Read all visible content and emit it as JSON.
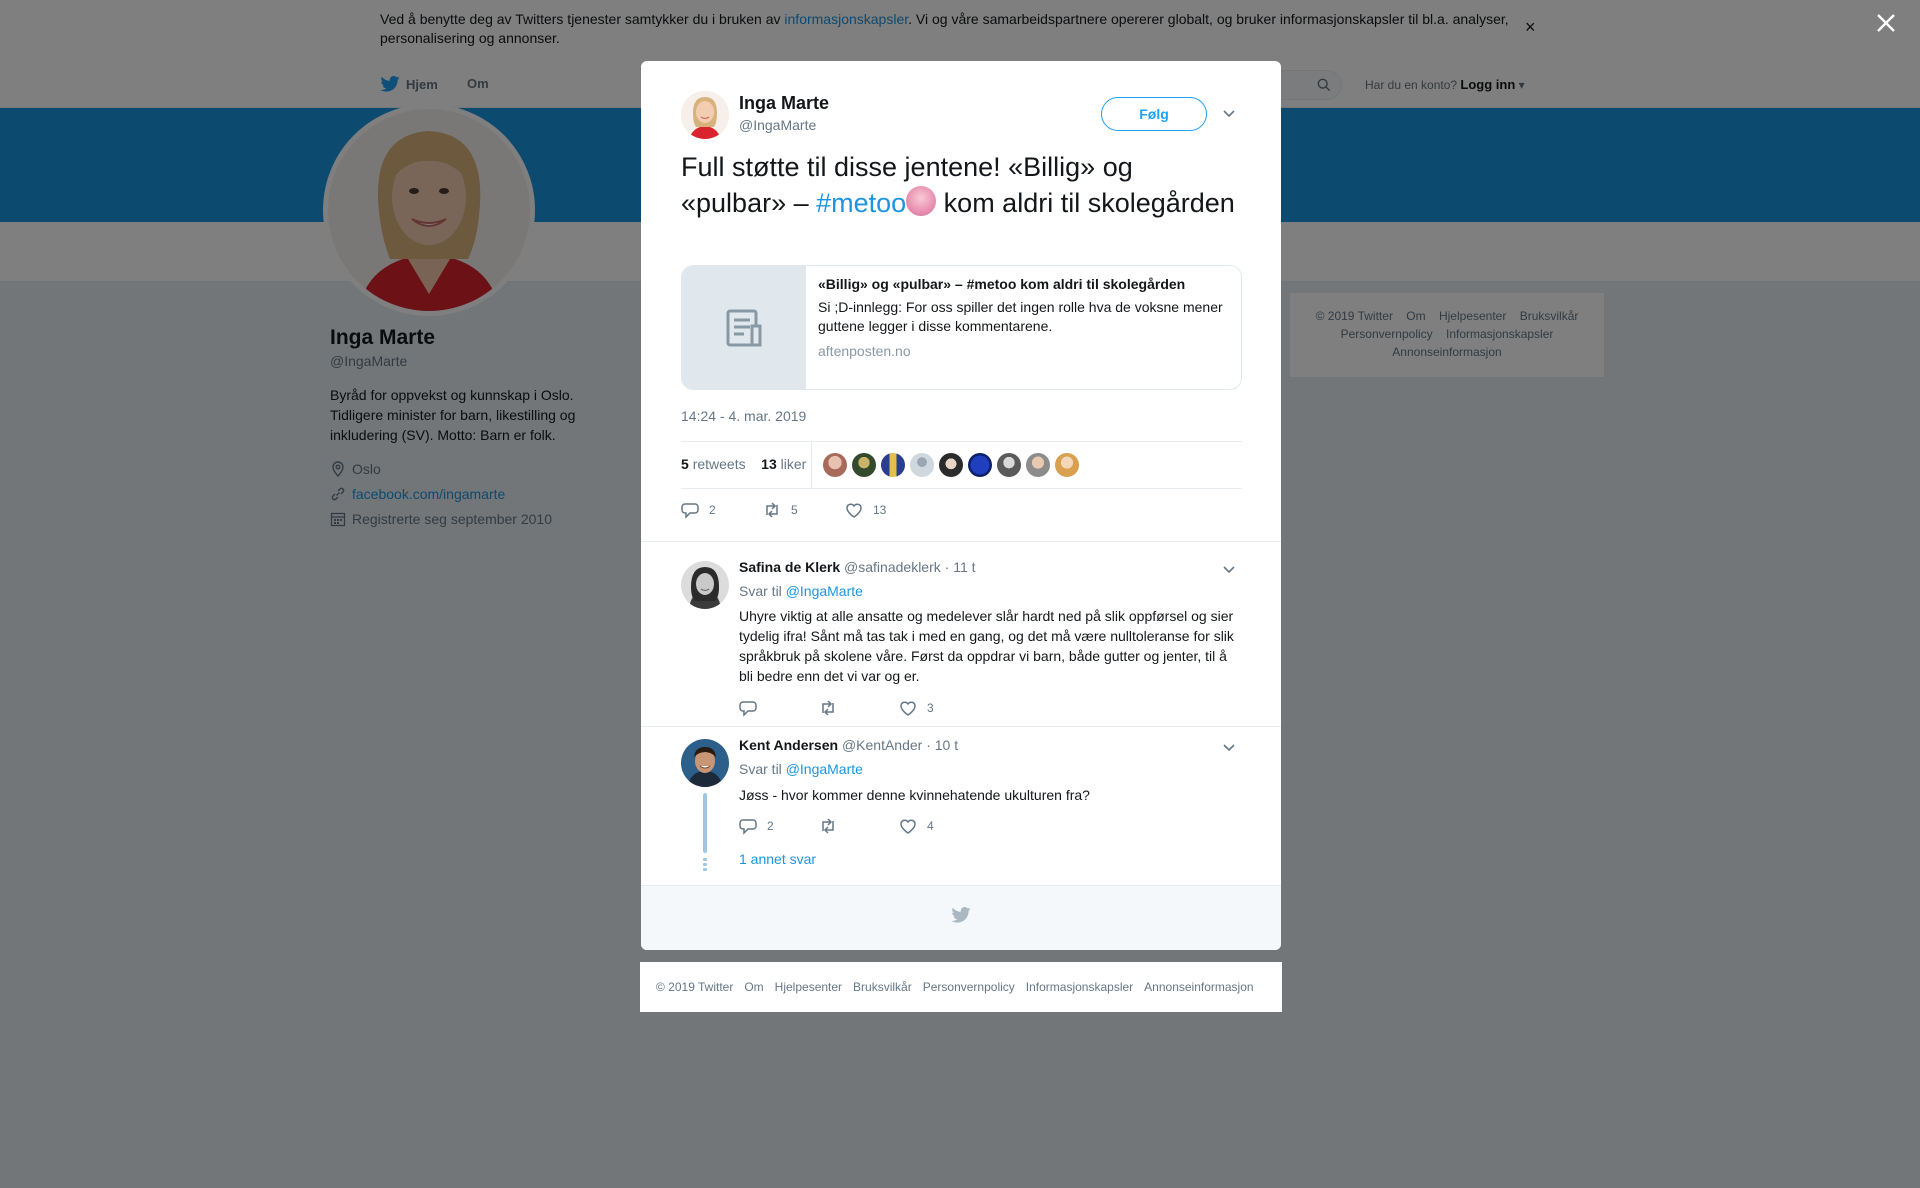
{
  "cookie": {
    "text_before": "Ved å benytte deg av Twitters tjenester samtykker du i bruken av ",
    "link": "informasjonskapsler",
    "text_after": ". Vi og våre samarbeidspartnere opererer globalt, og bruker informasjonskapsler til bl.a. analyser, personalisering og annonser.",
    "close": "×"
  },
  "nav": {
    "home": "Hjem",
    "about": "Om",
    "login_prompt": "Har du en konto?",
    "login": "Logg inn"
  },
  "profile": {
    "name": "Inga Marte",
    "handle": "@IngaMarte",
    "bio": "Byråd for oppvekst og kunnskap i Oslo. Tidligere minister for barn, likestilling og inkludering (SV). Motto: Barn er folk.",
    "location": "Oslo",
    "website": "facebook.com/ingamarte",
    "joined": "Registrerte seg september 2010"
  },
  "side_footer": {
    "links": [
      "© 2019 Twitter",
      "Om",
      "Hjelpesenter",
      "Bruksvilkår",
      "Personvernpolicy",
      "Informasjonskapsler",
      "Annonseinformasjon"
    ]
  },
  "tweet": {
    "author_name": "Inga Marte",
    "author_handle": "@IngaMarte",
    "follow_label": "Følg",
    "text_part1": "Full støtte til disse jentene! «Billig» og «pulbar» – ",
    "hashtag": "#metoo",
    "text_part2": " kom aldri til skolegården",
    "card_title": "«Billig» og «pulbar» – #metoo kom aldri til skolegården",
    "card_desc": "Si ;D-innlegg: For oss spiller det ingen rolle hva de voksne mener guttene legger i disse kommentarene.",
    "card_url": "aftenposten.no",
    "timestamp": "14:24 - 4. mar. 2019",
    "retweets_count": "5",
    "retweets_label": "retweets",
    "likes_count": "13",
    "likes_label": "liker",
    "reply_count": "2",
    "retweet_count_action": "5",
    "like_count_action": "13"
  },
  "replies": [
    {
      "name": "Safina de Klerk",
      "handle": "@safinadeklerk",
      "time": "· 11 t",
      "reply_to_label": "Svar til",
      "reply_to": "@IngaMarte",
      "text": "Uhyre viktig at alle ansatte og medelever slår hardt ned på slik oppførsel og sier tydelig ifra! Sånt må tas tak i med en gang, og det må være nulltoleranse for slik språkbruk på skolene våre. Først da oppdrar vi barn, både gutter og jenter, til å bli bedre enn det vi var og er.",
      "replies": "",
      "retweets": "",
      "likes": "3"
    },
    {
      "name": "Kent Andersen",
      "handle": "@KentAnder",
      "time": "· 10 t",
      "reply_to_label": "Svar til",
      "reply_to": "@IngaMarte",
      "text": "Jøss - hvor kommer denne kvinnehatende ukulturen fra?",
      "replies": "2",
      "retweets": "",
      "likes": "4",
      "more": "1 annet svar"
    }
  ],
  "bottom_footer": {
    "links": [
      "© 2019 Twitter",
      "Om",
      "Hjelpesenter",
      "Bruksvilkår",
      "Personvernpolicy",
      "Informasjonskapsler",
      "Annonseinformasjon"
    ]
  },
  "colors": {
    "twitter_blue": "#1da1f2",
    "link_blue": "#1b95e0",
    "banner": "#1b95e0"
  }
}
